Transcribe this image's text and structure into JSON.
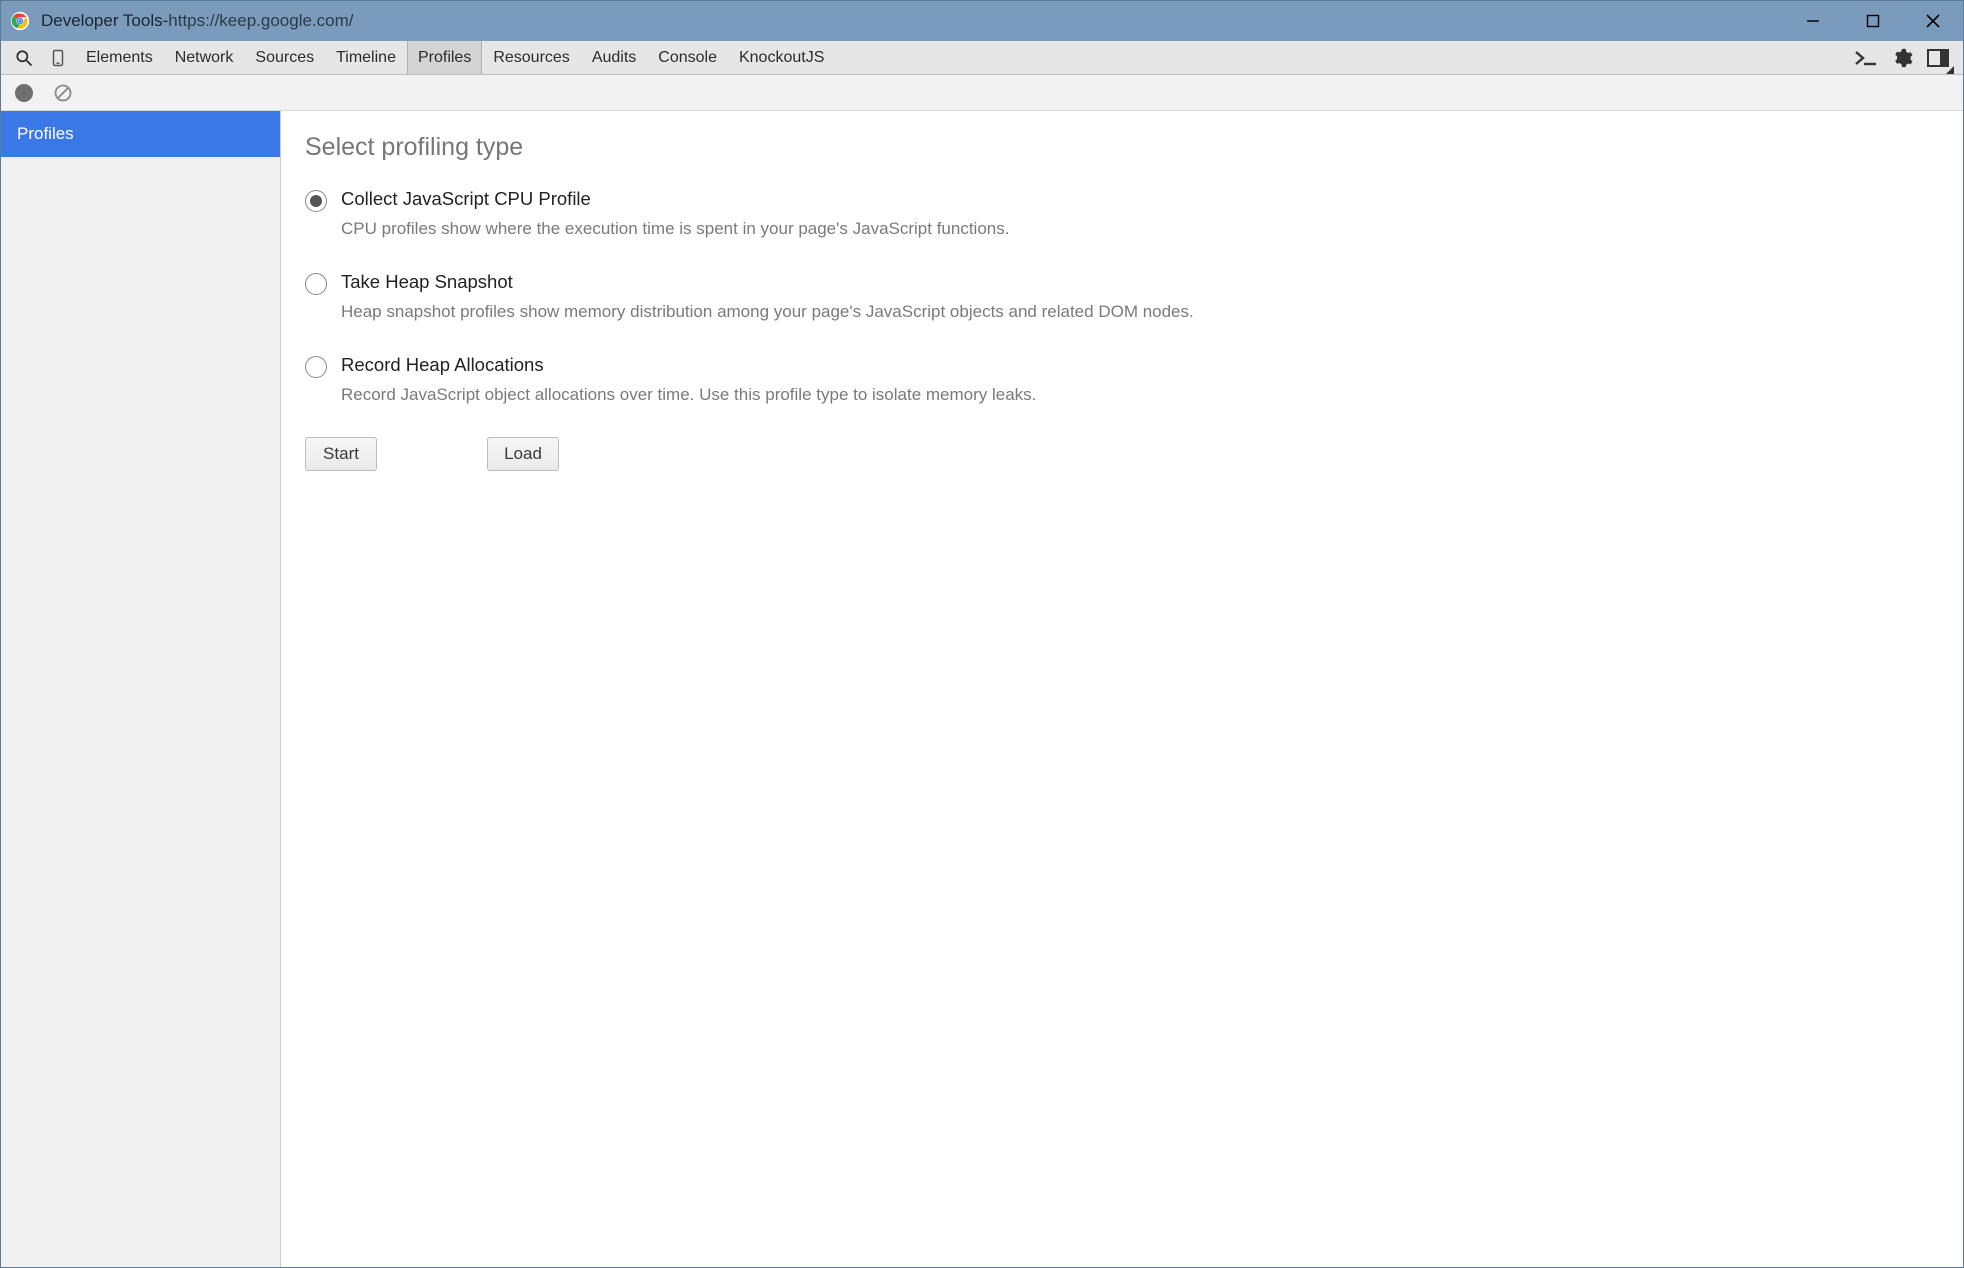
{
  "window": {
    "app_name": "Developer Tools",
    "separator": " - ",
    "url": "https://keep.google.com/"
  },
  "tabs": {
    "items": [
      "Elements",
      "Network",
      "Sources",
      "Timeline",
      "Profiles",
      "Resources",
      "Audits",
      "Console",
      "KnockoutJS"
    ],
    "active_index": 4
  },
  "sidebar": {
    "items": [
      {
        "label": "Profiles",
        "active": true
      }
    ]
  },
  "panel": {
    "heading": "Select profiling type",
    "options": [
      {
        "title": "Collect JavaScript CPU Profile",
        "description": "CPU profiles show where the execution time is spent in your page's JavaScript functions.",
        "checked": true
      },
      {
        "title": "Take Heap Snapshot",
        "description": "Heap snapshot profiles show memory distribution among your page's JavaScript objects and related DOM nodes.",
        "checked": false
      },
      {
        "title": "Record Heap Allocations",
        "description": "Record JavaScript object allocations over time. Use this profile type to isolate memory leaks.",
        "checked": false
      }
    ],
    "buttons": {
      "start": "Start",
      "load": "Load"
    }
  }
}
